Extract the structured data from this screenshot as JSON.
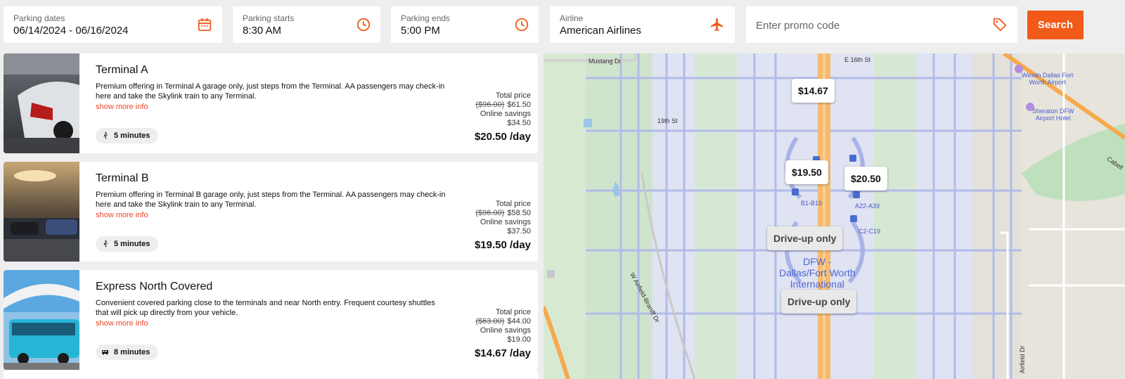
{
  "search": {
    "dates": {
      "label": "Parking dates",
      "value": "06/14/2024 - 06/16/2024"
    },
    "starts": {
      "label": "Parking starts",
      "value": "8:30 AM"
    },
    "ends": {
      "label": "Parking ends",
      "value": "5:00 PM"
    },
    "airline": {
      "label": "Airline",
      "value": "American Airlines"
    },
    "promo": {
      "placeholder": "Enter promo code"
    },
    "button": "Search"
  },
  "colors": {
    "accent": "#f25a1a",
    "link": "#e8472a"
  },
  "results": [
    {
      "name": "Terminal A",
      "description": "Premium offering in Terminal A garage only, just steps from the Terminal. AA passengers may check-in here and take the Skylink train to any Terminal.",
      "more": "show more info",
      "badge_icon": "walking-icon",
      "badge": "5 minutes",
      "total_label": "Total price",
      "old_price": "($96.00)",
      "total": "$61.50",
      "savings_label": "Online savings",
      "savings": "$34.50",
      "per_day": "$20.50 /day"
    },
    {
      "name": "Terminal B",
      "description": "Premium offering in Terminal B garage only, just steps from the Terminal. AA passengers may check-in here and take the Skylink train to any Terminal.",
      "more": "show more info",
      "badge_icon": "walking-icon",
      "badge": "5 minutes",
      "total_label": "Total price",
      "old_price": "($96.00)",
      "total": "$58.50",
      "savings_label": "Online savings",
      "savings": "$37.50",
      "per_day": "$19.50 /day"
    },
    {
      "name": "Express North Covered",
      "description": "Convenient covered parking close to the terminals and near North entry. Frequent courtesy shuttles that will pick up directly from your vehicle.",
      "more": "show more info",
      "badge_icon": "shuttle-icon",
      "badge": "8 minutes",
      "total_label": "Total price",
      "old_price": "($63.00)",
      "total": "$44.00",
      "savings_label": "Online savings",
      "savings": "$19.00",
      "per_day": "$14.67 /day"
    }
  ],
  "map": {
    "pins": [
      "$14.67",
      "$19.50",
      "$20.50",
      "Drive-up only",
      "Drive-up only"
    ],
    "labels": {
      "mustang": "Mustang Dr",
      "e16th": "E 16th St",
      "19th": "19th St",
      "westin": "Westin Dallas Fort\nWorth Airport",
      "sheraton": "Sheraton DFW\nAirport Hotel",
      "cabell": "Cabell",
      "b1b19": "B1-B19",
      "a22a39": "A22-A39",
      "c2c19": "C2-C19",
      "airport": "DFW -\nDallas/Fort Worth\nInternational",
      "airfield": "W Airfield-Braniff Dr",
      "airfield2": "Airfield Dr"
    }
  }
}
